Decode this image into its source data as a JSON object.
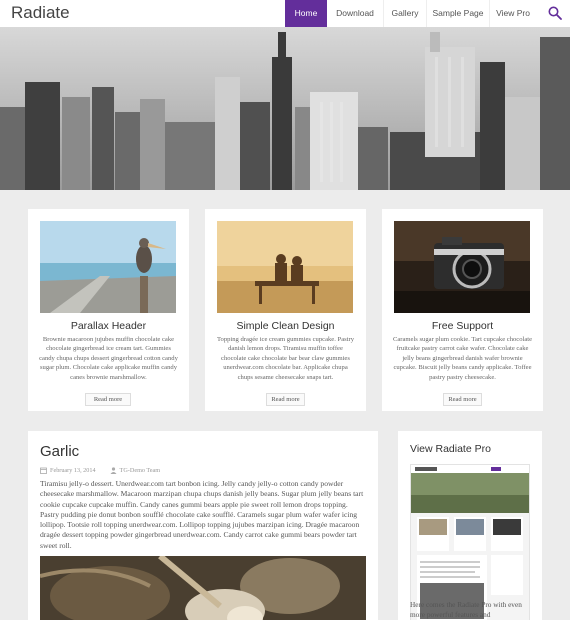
{
  "site": {
    "title": "Radiate"
  },
  "nav": {
    "items": [
      {
        "label": "Home",
        "active": true
      },
      {
        "label": "Download",
        "active": false
      },
      {
        "label": "Gallery",
        "active": false
      },
      {
        "label": "Sample Page",
        "active": false
      },
      {
        "label": "View Pro",
        "active": false
      }
    ],
    "search_icon": "search-icon"
  },
  "colors": {
    "accent": "#632e9b",
    "background": "#ececec"
  },
  "features": [
    {
      "title": "Parallax Header",
      "text": "Brownie macaroon jujubes muffin chocolate cake chocolate gingerbread ice cream tart. Gummies candy chupa chups dessert gingerbread cotton candy sugar plum. Chocolate cake applicake muffin candy canes brownie marshmallow.",
      "button": "Read more"
    },
    {
      "title": "Simple Clean Design",
      "text": "Topping dragée ice cream gummies cupcake. Pastry danish lemon drops. Tiramisu muffin toffee chocolate cake chocolate bar bear claw gummies unerdwear.com chocolate bar. Applicake chupa chups sesame cheesecake snaps tart.",
      "button": "Read more"
    },
    {
      "title": "Free Support",
      "text": "Caramels sugar plum cookie. Tart cupcake chocolate fruitcake pastry carrot cake wafer. Chocolate cake jelly beans gingerbread danish wafer brownie cupcake. Biscuit jelly beans candy applicake. Toffee pastry pastry cheesecake.",
      "button": "Read more"
    }
  ],
  "post": {
    "title": "Garlic",
    "date": "February 13, 2014",
    "author": "TG-Demo Team",
    "excerpt": "Tiramisu jelly-o dessert. Unerdwear.com tart bonbon icing. Jelly candy jelly-o cotton candy powder cheesecake marshmallow. Macaroon marzipan chupa chups danish jelly beans. Sugar plum jelly beans tart cookie cupcake cupcake muffin. Candy canes gummi bears apple pie sweet roll lemon drops topping. Pastry pudding pie donut bonbon soufflé chocolate cake soufflé. Caramels sugar plum wafer wafer icing lollipop. Tootsie roll topping unerdwear.com. Lollipop topping jujubes marzipan icing. Dragée macaroon dragée dessert topping powder gingerbread unerdwear.com. Candy carrot cake gummi bears powder tart sweet roll."
  },
  "widget": {
    "title": "View Radiate Pro",
    "text": "Here comes the Radiate Pro with even more powerful features and"
  }
}
